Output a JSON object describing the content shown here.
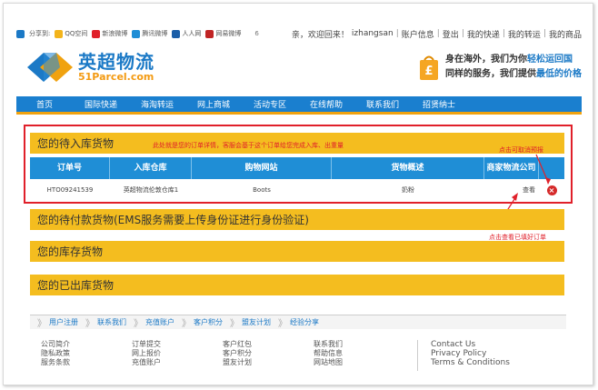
{
  "share": {
    "label": "分享到:",
    "items": [
      {
        "name": "QQ空间",
        "color": "#f3b41b"
      },
      {
        "name": "新浪微博",
        "color": "#e0202a"
      },
      {
        "name": "腾讯微博",
        "color": "#1f8ed6"
      },
      {
        "name": "人人网",
        "color": "#1b5ea8"
      },
      {
        "name": "网易微博",
        "color": "#c02424"
      }
    ],
    "count": "6"
  },
  "user": {
    "greeting": "亲，欢迎回来！",
    "username": "izhangsan",
    "links": [
      "账户信息",
      "登出",
      "我的快递",
      "我的转运",
      "我的商品"
    ]
  },
  "logo": {
    "cn": "英超物流",
    "en": "51Parcel.com"
  },
  "slogan": {
    "line1_a": "身在海外，我们为你",
    "line1_b": "轻松运回国",
    "line2_a": "同样的服务，我们提供",
    "line2_b": "最低的价格"
  },
  "nav": [
    "首页",
    "国际快递",
    "海淘转运",
    "网上商城",
    "活动专区",
    "在线帮助",
    "联系我们",
    "招贤纳士"
  ],
  "sections": {
    "pending_in": "您的待入库货物",
    "pending_pay": "您的待付款货物(EMS服务需要上传身份证进行身份验证)",
    "stock": "您的库存货物",
    "shipped": "您的已出库货物"
  },
  "annotations": {
    "order_detail": "此处就是您的订单详情，客服会基于这个订单给您完成入库、出重量",
    "cancel_hint": "点击可取消预报",
    "view_hint": "点击查看已填好订单"
  },
  "table": {
    "headers": [
      "订单号",
      "入库仓库",
      "购物网站",
      "货物概述",
      "商家物流公司"
    ],
    "row": {
      "order_no": "HTO09241539",
      "warehouse": "英超物流伦敦仓库1",
      "site": "Boots",
      "goods": "奶粉",
      "carrier": "",
      "view": "查看"
    }
  },
  "footer": {
    "links": [
      "用户注册",
      "联系我们",
      "充值账户",
      "客户积分",
      "盟友计划",
      "经验分享"
    ],
    "col1": [
      "公司简介",
      "隐私政策",
      "服务条款"
    ],
    "col2": [
      "订单提交",
      "网上报价",
      "充值账户"
    ],
    "col3": [
      "客户红包",
      "客户积分",
      "盟友计划"
    ],
    "col4": [
      "联系我们",
      "帮助信息",
      "网站地图"
    ],
    "col5": [
      "Contact Us",
      "Privacy Policy",
      "Terms & Conditions"
    ]
  },
  "colors": {
    "brand_blue": "#1a7fcf",
    "brand_orange": "#f0a20f",
    "section_yellow": "#f4bd1f",
    "annotation_red": "#e0202a"
  }
}
